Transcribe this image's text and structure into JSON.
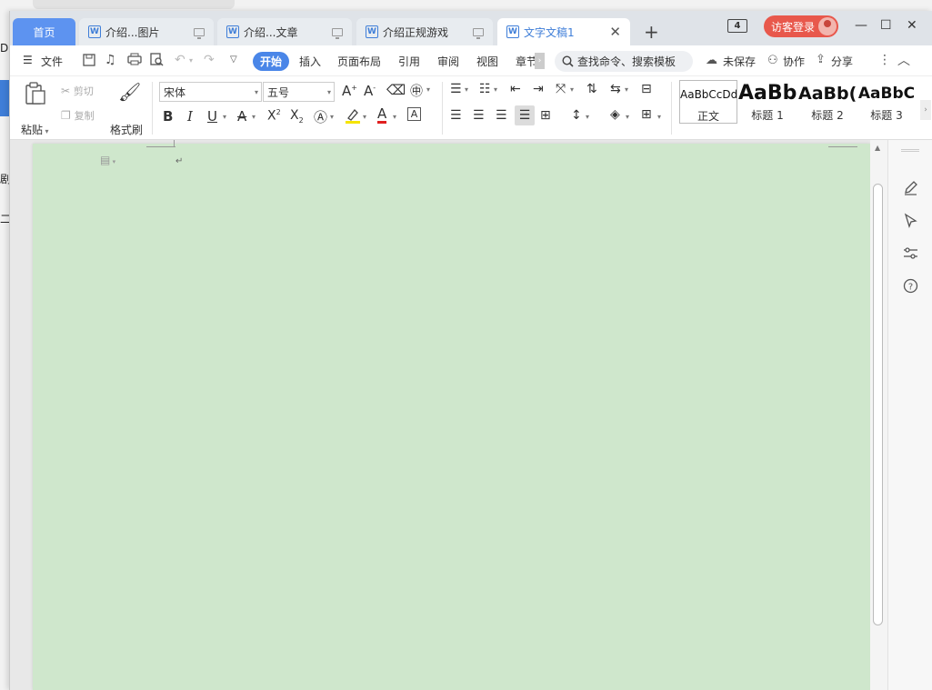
{
  "backdrop": {
    "text_fragments": [
      "Da",
      "剧",
      "二"
    ]
  },
  "tabs": [
    {
      "label": "首页",
      "type": "home"
    },
    {
      "label": "介绍...图片",
      "type": "doc"
    },
    {
      "label": "介绍...文章",
      "type": "doc"
    },
    {
      "label": "介绍正规游戏",
      "type": "doc"
    },
    {
      "label": "文字文稿1",
      "type": "doc",
      "active": true
    }
  ],
  "titlebar": {
    "new_tab": "+",
    "window_count": "4",
    "login_label": "访客登录",
    "minimize": "—",
    "maximize": "☐",
    "close": "✕"
  },
  "menu": {
    "file": "文件",
    "items": [
      "开始",
      "插入",
      "页面布局",
      "引用",
      "审阅",
      "视图",
      "章节"
    ],
    "active": "开始",
    "search_placeholder": "查找命令、搜索模板",
    "unsaved": "未保存",
    "collab": "协作",
    "share": "分享"
  },
  "ribbon": {
    "paste": "粘贴",
    "cut": "剪切",
    "copy": "复制",
    "format_painter": "格式刷",
    "font_name": "宋体",
    "font_size": "五号",
    "styles": [
      {
        "preview": "AaBbCcDd",
        "name": "正文"
      },
      {
        "preview": "AaBb",
        "name": "标题 1"
      },
      {
        "preview": "AaBb(",
        "name": "标题 2"
      },
      {
        "preview": "AaBbC",
        "name": "标题 3"
      }
    ]
  },
  "document": {
    "paragraph_mark": "↵"
  },
  "colors": {
    "accent": "#4a86e8",
    "home_tab": "#5d93f0",
    "login": "#e8584c",
    "page_bg": "#cfe7cc"
  }
}
